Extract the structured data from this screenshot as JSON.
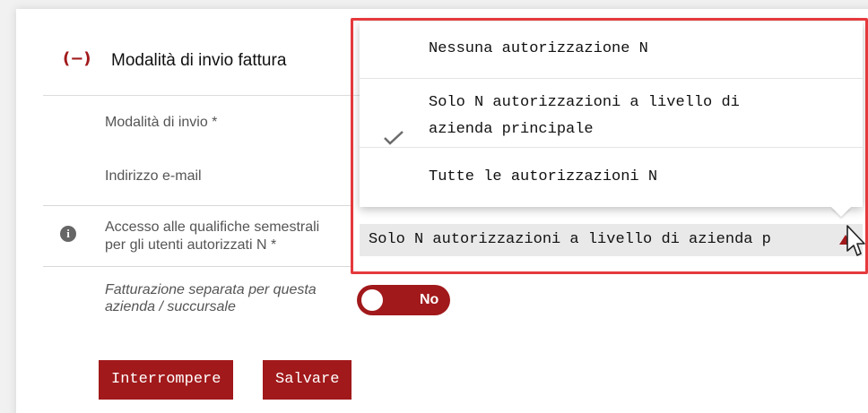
{
  "section": {
    "collapse_symbol": "(−)",
    "title": "Modalità di invio fattura"
  },
  "fields": {
    "send_mode_label": "Modalità di invio *",
    "email_label": "Indirizzo e-mail",
    "access_label_line1": "Accesso alle qualifiche semestrali",
    "access_label_line2": "per gli utenti autorizzati N *",
    "separate_billing_line1": "Fatturazione separata per questa",
    "separate_billing_line2": "azienda / succursale"
  },
  "toggle": {
    "value_label": "No",
    "state": "off"
  },
  "dropdown": {
    "options": [
      {
        "line1": "Nessuna autorizzazione N",
        "line2": ""
      },
      {
        "line1": "Solo N autorizzazioni a livello di",
        "line2": "azienda principale"
      },
      {
        "line1": "Tutte le autorizzazioni N",
        "line2": ""
      }
    ],
    "selected_index": 1,
    "selected_value": "Solo N autorizzazioni a livello di azienda principale",
    "selected_value_visible": "Solo N autorizzazioni a livello di azienda p"
  },
  "buttons": {
    "cancel_label": "Interrompere",
    "save_label": "Salvare"
  },
  "colors": {
    "brand_red": "#a1191b",
    "highlight_red": "#e5393c"
  },
  "icons": {
    "info": "info-icon",
    "check": "check-icon",
    "collapse": "collapse-icon",
    "cursor": "mouse-pointer-icon"
  }
}
